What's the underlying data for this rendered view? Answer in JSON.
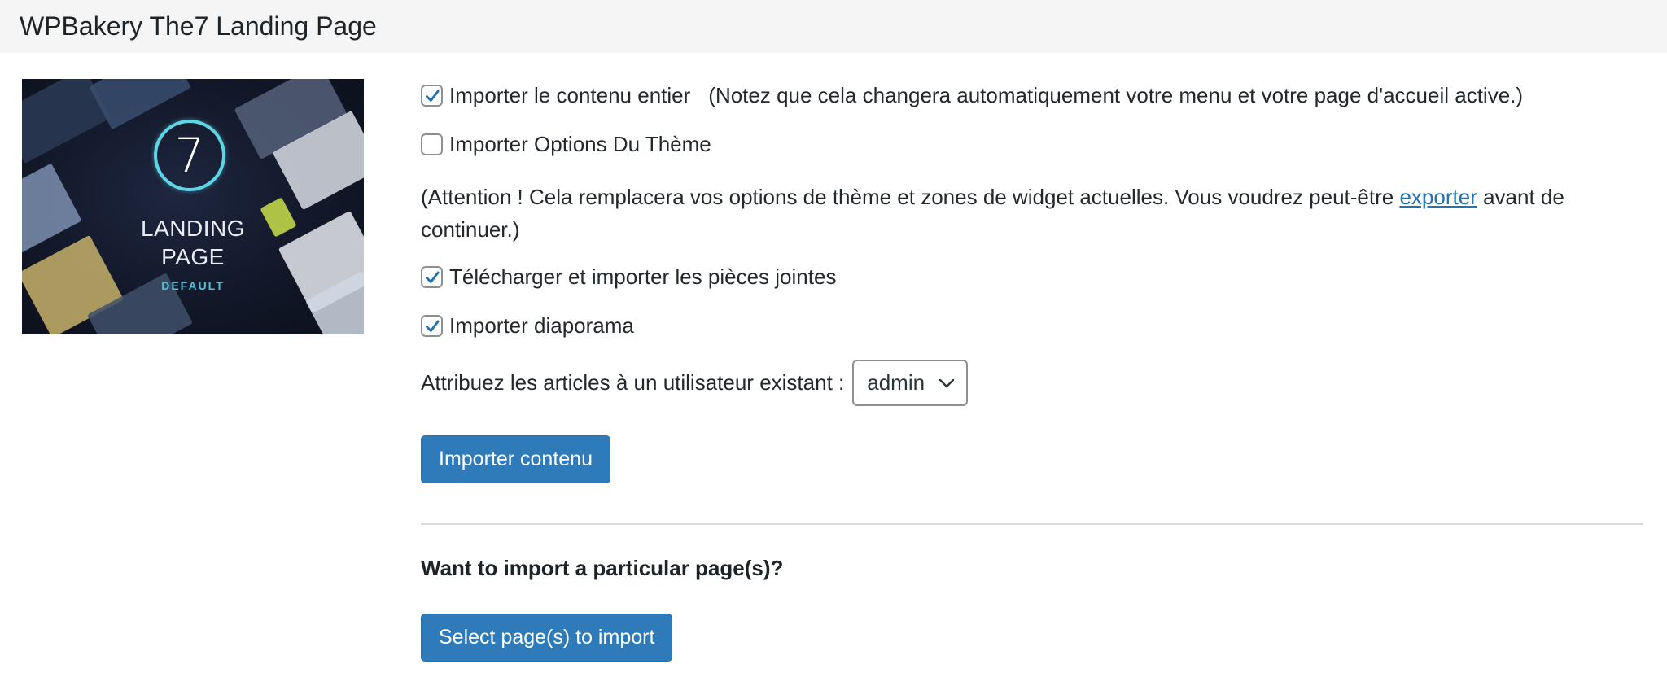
{
  "header": {
    "title": "WPBakery The7 Landing Page"
  },
  "thumbnail": {
    "number": "7",
    "line1": "LANDING",
    "line2": "PAGE",
    "subtitle": "DEFAULT",
    "accent_color": "#5fd6e6"
  },
  "options": {
    "import_content": {
      "label": "Importer le contenu entier",
      "note": "(Notez que cela changera automatiquement votre menu et votre page d'accueil active.)",
      "checked": true
    },
    "import_theme_options": {
      "label": "Importer Options Du Thème",
      "checked": false
    },
    "warning": {
      "text_before": "(Attention ! Cela remplacera vos options de thème et zones de widget actuelles. Vous voudrez peut-être ",
      "link": "exporter",
      "text_after": " avant de continuer.)"
    },
    "import_attachments": {
      "label": "Télécharger et importer les pièces jointes",
      "checked": true
    },
    "import_slideshow": {
      "label": "Importer diaporama",
      "checked": true
    }
  },
  "assign": {
    "label": "Attribuez les articles à un utilisateur existant :",
    "selected": "admin"
  },
  "buttons": {
    "import": "Importer contenu",
    "select_pages": "Select page(s) to import"
  },
  "question": "Want to import a particular page(s)?",
  "colors": {
    "primary_button": "#2f7ab9",
    "link": "#2271b1",
    "checkbox_check": "#2271b1"
  }
}
